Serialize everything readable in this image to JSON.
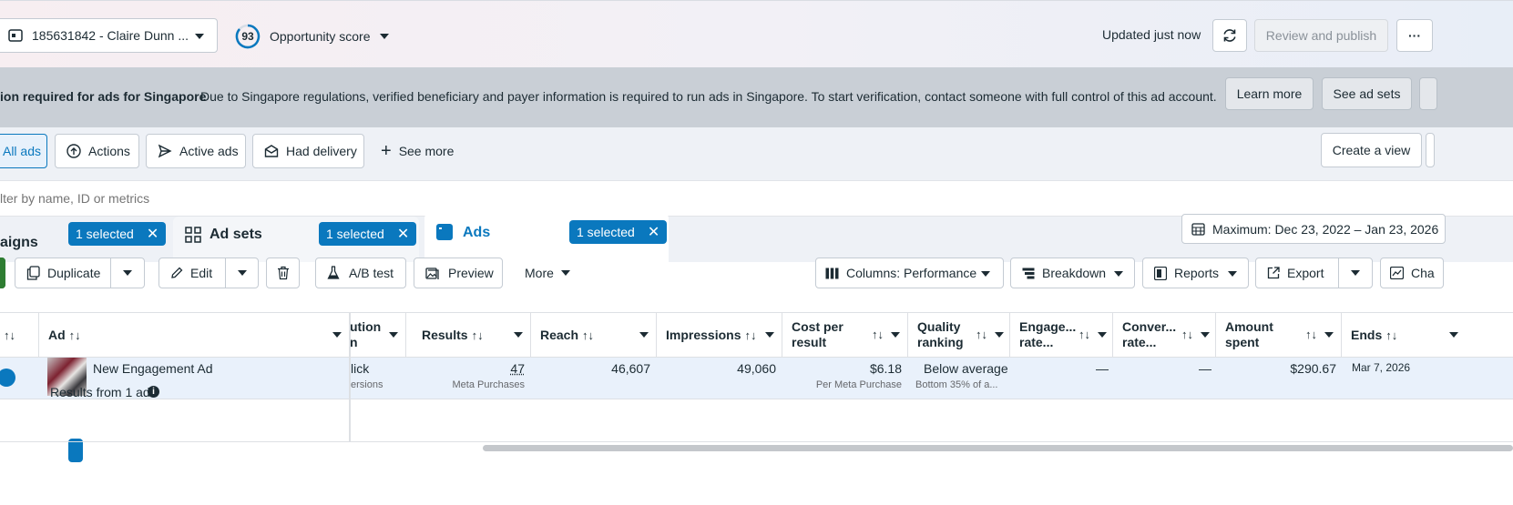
{
  "header": {
    "account_label": "185631842 - Claire Dunn ...",
    "score_value": "93",
    "score_label": "Opportunity score",
    "updated_text": "Updated just now",
    "review_button": "Review and publish",
    "more_button": "···"
  },
  "banner": {
    "title": "ion required for ads for Singapore",
    "message": "Due to Singapore regulations, verified beneficiary and payer information is required to run ads in Singapore. To start verification, contact someone with full control of this ad account.",
    "learn_more": "Learn more",
    "see_ad_sets": "See ad sets"
  },
  "filters": {
    "chips": [
      "All ads",
      "Actions",
      "Active ads",
      "Had delivery"
    ],
    "see_more": "See more",
    "create_view": "Create a view"
  },
  "search": {
    "placeholder": "lter by name, ID or metrics"
  },
  "tabs": {
    "campaigns": {
      "label": "aigns",
      "selected": "1 selected"
    },
    "ad_sets": {
      "label": "Ad sets",
      "selected": "1 selected"
    },
    "ads": {
      "label": "Ads",
      "selected": "1 selected"
    },
    "date_range": "Maximum: Dec 23, 2022 – Jan 23, 2026"
  },
  "toolbar": {
    "duplicate": "Duplicate",
    "edit": "Edit",
    "ab_test": "A/B test",
    "preview": "Preview",
    "more": "More",
    "columns": "Columns: Performance",
    "breakdown": "Breakdown",
    "reports": "Reports",
    "export": "Export",
    "charts": "Cha"
  },
  "table": {
    "headers": {
      "sort": "↑↓",
      "ad": "Ad",
      "attribution_1": "ution",
      "attribution_2": "n",
      "results": "Results",
      "reach": "Reach",
      "impressions": "Impressions",
      "cost_per_result_1": "Cost per",
      "cost_per_result_2": "result",
      "quality_1": "Quality",
      "quality_2": "ranking",
      "engagement_1": "Engage...",
      "engagement_2": "rate...",
      "conversion_1": "Conver...",
      "conversion_2": "rate...",
      "amount_1": "Amount",
      "amount_2": "spent",
      "ends": "Ends"
    },
    "row": {
      "ad_name": "New Engagement Ad",
      "attribution": "lick",
      "attribution_sub": "ersions",
      "results": "47",
      "results_sub": "Meta Purchases",
      "reach": "46,607",
      "impressions": "49,060",
      "cost_per_result": "$6.18",
      "cost_sub": "Per Meta Purchase",
      "quality": "Below average",
      "quality_sub": "Bottom 35% of a...",
      "engagement": "—",
      "conversion": "—",
      "amount_spent": "$290.67",
      "ends": "Mar 7, 2026"
    },
    "footer": "Results from 1 ad"
  },
  "colors": {
    "accent": "#0a78be",
    "banner_bg": "#c9cfd6",
    "row_selected": "#e9f1fb"
  }
}
